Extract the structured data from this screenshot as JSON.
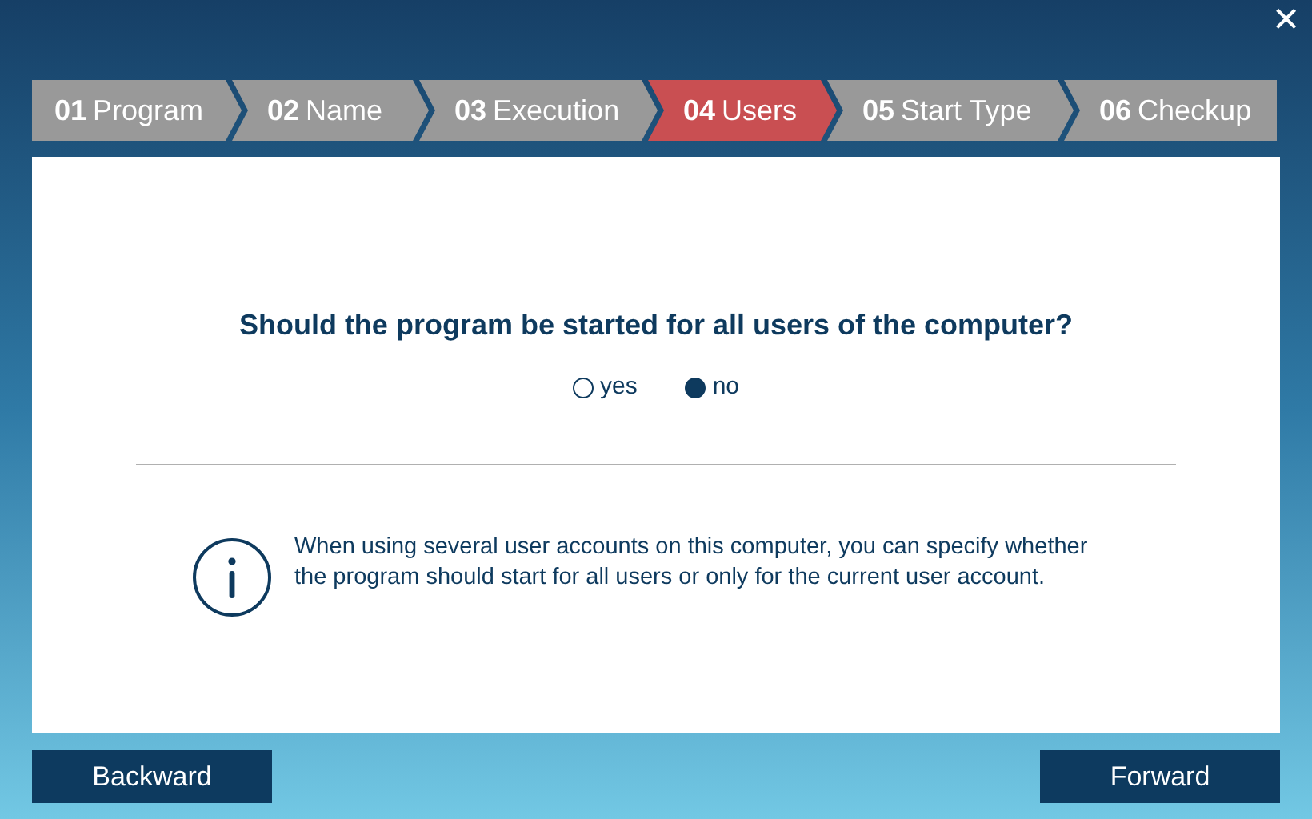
{
  "close_button": {
    "label": "×"
  },
  "steps": [
    {
      "number": "01",
      "label": "Program",
      "selected": false
    },
    {
      "number": "02",
      "label": "Name",
      "selected": false
    },
    {
      "number": "03",
      "label": "Execution",
      "selected": false
    },
    {
      "number": "04",
      "label": "Users",
      "selected": true
    },
    {
      "number": "05",
      "label": "Start Type",
      "selected": false
    },
    {
      "number": "06",
      "label": "Checkup",
      "selected": false
    }
  ],
  "question": "Should the program be started for all users of the computer?",
  "options": [
    {
      "label": "yes",
      "selected": false
    },
    {
      "label": "no",
      "selected": true
    }
  ],
  "info": "When using several user accounts on this computer, you can specify whether the program should start for all users or only for the current user account.",
  "buttons": [
    {
      "label": "Backward"
    },
    {
      "label": "Forward"
    }
  ]
}
